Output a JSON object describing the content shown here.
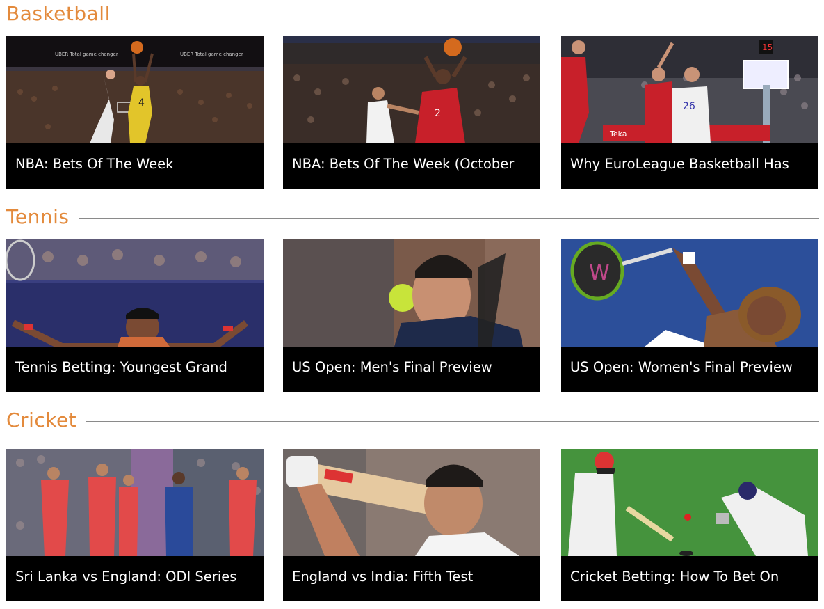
{
  "sections": [
    {
      "title": "Basketball",
      "cards": [
        {
          "caption": "NBA: Bets Of The Week",
          "image": "basketball-player-shooting-image"
        },
        {
          "caption": "NBA: Bets Of The Week (October",
          "image": "raptors-player-shooting-image"
        },
        {
          "caption": "Why EuroLeague Basketball Has",
          "image": "euroleague-game-image"
        }
      ]
    },
    {
      "title": "Tennis",
      "cards": [
        {
          "caption": "Tennis Betting: Youngest Grand",
          "image": "tennis-player-celebrating-image"
        },
        {
          "caption": "US Open: Men's Final Preview",
          "image": "tennis-player-returning-image"
        },
        {
          "caption": "US Open: Women's Final Preview",
          "image": "tennis-player-serving-image"
        }
      ]
    },
    {
      "title": "Cricket",
      "cards": [
        {
          "caption": "Sri Lanka vs England: ODI Series",
          "image": "cricket-team-celebrating-image"
        },
        {
          "caption": "England vs India: Fifth Test",
          "image": "cricket-batsman-closeup-image"
        },
        {
          "caption": "Cricket Betting: How To Bet On",
          "image": "cricket-batsman-wicketkeeper-image"
        }
      ]
    }
  ]
}
